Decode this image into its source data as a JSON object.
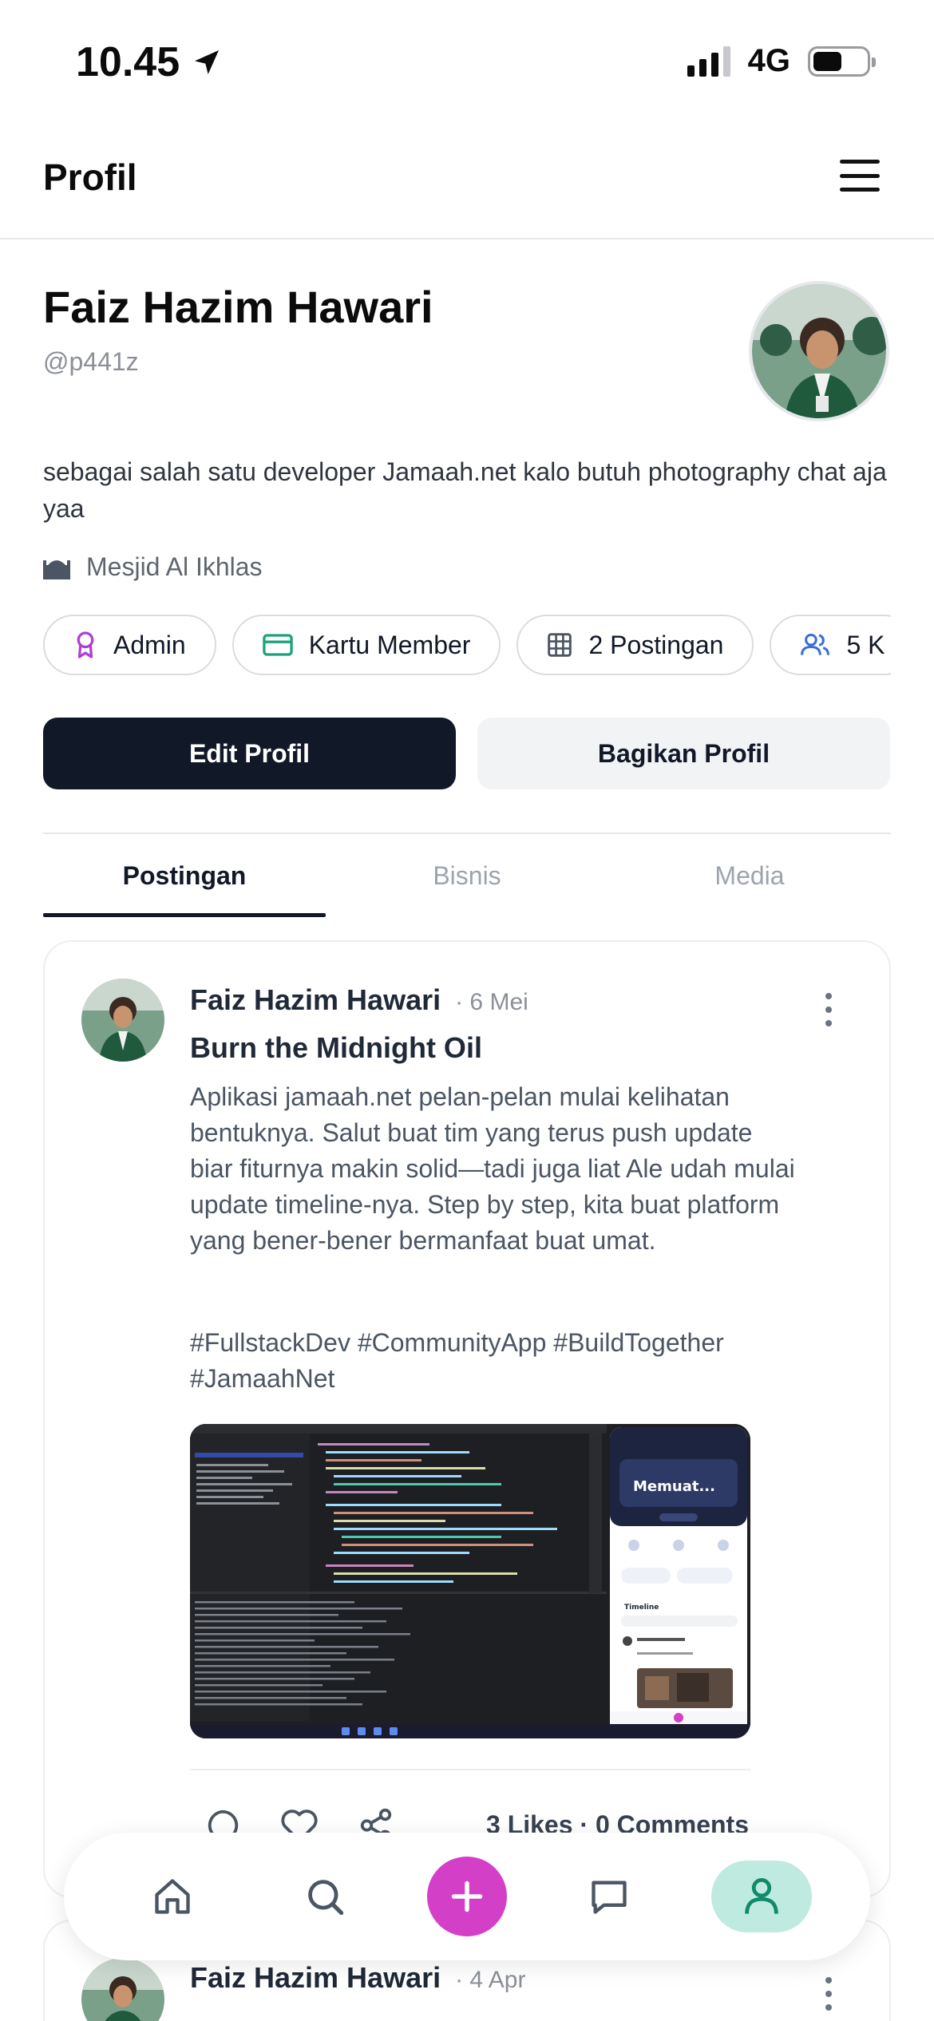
{
  "status_bar": {
    "time": "10.45",
    "network": "4G"
  },
  "header": {
    "title": "Profil"
  },
  "profile": {
    "name": "Faiz Hazim Hawari",
    "handle": "@p441z",
    "bio": "sebagai salah satu developer Jamaah.net kalo butuh photography chat aja yaa",
    "location": "Mesjid Al Ikhlas",
    "chips": [
      {
        "label": "Admin",
        "icon": "award-icon"
      },
      {
        "label": "Kartu Member",
        "icon": "card-icon"
      },
      {
        "label": "2 Postingan",
        "icon": "grid-icon"
      },
      {
        "label": "5 K",
        "icon": "users-icon"
      }
    ],
    "edit_label": "Edit Profil",
    "share_label": "Bagikan Profil"
  },
  "tabs": [
    {
      "label": "Postingan",
      "active": true
    },
    {
      "label": "Bisnis",
      "active": false
    },
    {
      "label": "Media",
      "active": false
    }
  ],
  "posts": [
    {
      "author": "Faiz Hazim Hawari",
      "date": "· 6 Mei",
      "title": "Burn the Midnight Oil",
      "body": "Aplikasi jamaah.net pelan-pelan mulai kelihatan bentuknya. Salut buat tim yang terus push update biar fiturnya makin solid—tadi juga liat Ale udah mulai update timeline-nya. Step by step, kita buat platform yang bener-bener bermanfaat buat umat.",
      "tags": "#FullstackDev #CommunityApp #BuildTogether #JamaahNet",
      "stats": "3 Likes · 0 Comments",
      "image": {
        "phone_title": "Memuat...",
        "phone_section": "Timeline"
      }
    },
    {
      "author": "Faiz Hazim Hawari",
      "date": "· 4 Apr"
    }
  ],
  "colors": {
    "primary_dark": "#111827",
    "accent_add": "#d43fc8",
    "active_nav": "#bfeadf",
    "admin_icon": "#b03ed6",
    "card_icon": "#1aa37a",
    "users_icon": "#3b6fd6"
  },
  "bottom_nav": [
    {
      "icon": "home-icon"
    },
    {
      "icon": "search-icon"
    },
    {
      "icon": "plus-icon"
    },
    {
      "icon": "chat-icon"
    },
    {
      "icon": "profile-icon",
      "active": true
    }
  ]
}
